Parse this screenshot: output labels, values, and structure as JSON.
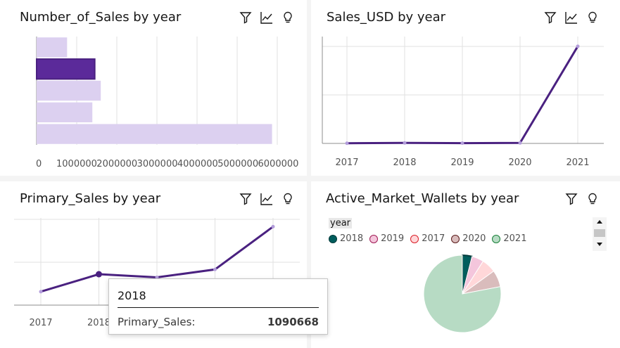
{
  "colors": {
    "accent": "#5b2a9a",
    "accent_dark": "#4a2180",
    "bar_light": "#dcd0f0",
    "grid": "#e0e0e0",
    "axis": "#8d8d8d"
  },
  "toolbar_icons": [
    "filter-icon",
    "line-chart-icon",
    "lightbulb-icon"
  ],
  "panels": {
    "p1": {
      "title": "Number_of_Sales by year"
    },
    "p2": {
      "title": "Sales_USD by year"
    },
    "p3": {
      "title": "Primary_Sales by year"
    },
    "p4": {
      "title": "Active_Market_Wallets by year",
      "legend_title": "year"
    }
  },
  "tooltip": {
    "header": "2018",
    "label": "Primary_Sales:",
    "value": "1090668"
  },
  "chart_data": [
    {
      "type": "bar",
      "orientation": "horizontal",
      "title": "Number_of_Sales by year",
      "x_ticks": [
        "0",
        "1000000",
        "2000000",
        "3000000",
        "4000000",
        "5000000",
        "6000000"
      ],
      "xlim": [
        0,
        6000000
      ],
      "values": [
        760000,
        1450000,
        1600000,
        1390000,
        5870000
      ],
      "highlighted_index": 1,
      "grid": true
    },
    {
      "type": "line",
      "title": "Sales_USD by year",
      "categories": [
        "2017",
        "2018",
        "2019",
        "2020",
        "2021"
      ],
      "values": [
        0.002,
        0.005,
        0.003,
        0.005,
        1.0
      ],
      "ylim": [
        0,
        1.1
      ],
      "y_grid_count": 3,
      "grid": true
    },
    {
      "type": "line",
      "title": "Primary_Sales by year",
      "categories": [
        "2017",
        "2018",
        "2019",
        "2020",
        "2021"
      ],
      "values": [
        0.17,
        0.39,
        0.35,
        0.45,
        0.99
      ],
      "ylim": [
        0,
        1.1
      ],
      "y_grid_count": 3,
      "grid": true
    },
    {
      "type": "pie",
      "title": "Active_Market_Wallets by year",
      "legend_title": "year",
      "legend_position": "top-left",
      "series": [
        {
          "name": "2018",
          "value": 4,
          "color": "#005d5d",
          "border": "#003a3a"
        },
        {
          "name": "2019",
          "value": 5,
          "color": "#f4c6dc",
          "border": "#9f1853"
        },
        {
          "name": "2017",
          "value": 6,
          "color": "#ffd7d9",
          "border": "#da1e28"
        },
        {
          "name": "2020",
          "value": 7,
          "color": "#d9bcbc",
          "border": "#5a1a1a"
        },
        {
          "name": "2021",
          "value": 78,
          "color": "#b7dbc4",
          "border": "#198038"
        }
      ]
    }
  ]
}
